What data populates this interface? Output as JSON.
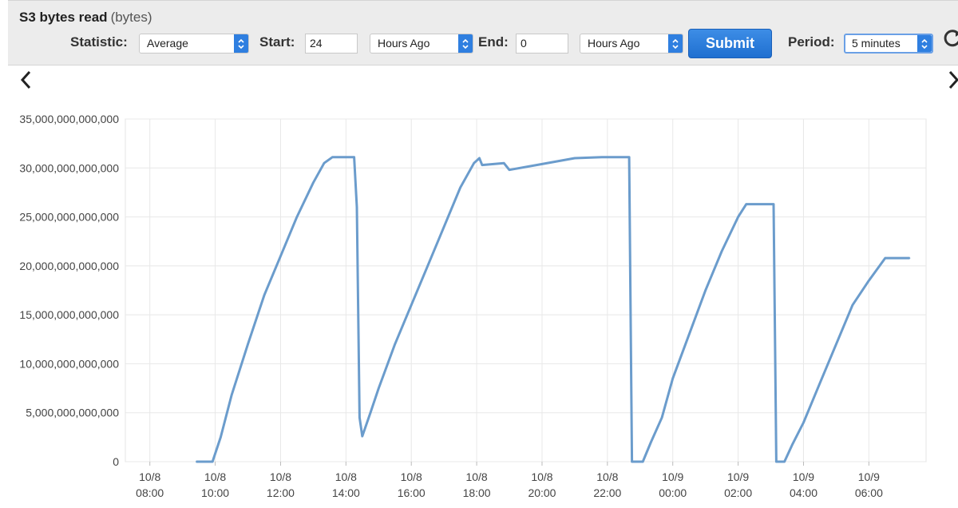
{
  "toolbar": {
    "title": "S3 bytes read",
    "units": "(bytes)",
    "statistic_label": "Statistic:",
    "statistic_value": "Average",
    "start_label": "Start:",
    "start_value": "24",
    "start_unit": "Hours Ago",
    "end_label": "End:",
    "end_value": "0",
    "end_unit": "Hours Ago",
    "submit_label": "Submit",
    "period_label": "Period:",
    "period_value": "5 minutes"
  },
  "icons": {
    "select_arrow": "up-down-chevron-icon",
    "prev": "chevron-left-icon",
    "next": "chevron-right-icon",
    "refresh": "refresh-icon"
  },
  "colors": {
    "line": "#6b9ccc",
    "accent": "#2f7fe0",
    "grid": "#e8e8e8"
  },
  "chart_data": {
    "type": "line",
    "title": "S3 bytes read",
    "ylabel": "(bytes)",
    "xlabel": "",
    "ylim": [
      0,
      35000000000000
    ],
    "xlim": [
      "10/8 07:15",
      "10/9 07:45"
    ],
    "grid": true,
    "y_ticks": [
      0,
      5000000000000,
      10000000000000,
      15000000000000,
      20000000000000,
      25000000000000,
      30000000000000,
      35000000000000
    ],
    "y_tick_labels": [
      "0",
      "5,000,000,000,000",
      "10,000,000,000,000",
      "15,000,000,000,000",
      "20,000,000,000,000",
      "25,000,000,000,000",
      "30,000,000,000,000",
      "35,000,000,000,000"
    ],
    "x_ticks": [
      "10/8 08:00",
      "10/8 10:00",
      "10/8 12:00",
      "10/8 14:00",
      "10/8 16:00",
      "10/8 18:00",
      "10/8 20:00",
      "10/8 22:00",
      "10/9 00:00",
      "10/9 02:00",
      "10/9 04:00",
      "10/9 06:00"
    ],
    "x_tick_labels": [
      [
        "10/8",
        "08:00"
      ],
      [
        "10/8",
        "10:00"
      ],
      [
        "10/8",
        "12:00"
      ],
      [
        "10/8",
        "14:00"
      ],
      [
        "10/8",
        "16:00"
      ],
      [
        "10/8",
        "18:00"
      ],
      [
        "10/8",
        "20:00"
      ],
      [
        "10/8",
        "22:00"
      ],
      [
        "10/9",
        "00:00"
      ],
      [
        "10/9",
        "02:00"
      ],
      [
        "10/9",
        "04:00"
      ],
      [
        "10/9",
        "06:00"
      ]
    ],
    "series": [
      {
        "points": [
          [
            "10/8 09:25",
            0
          ],
          [
            "10/8 09:55",
            0
          ],
          [
            "10/8 10:10",
            2500000000000
          ],
          [
            "10/8 10:30",
            6800000000000
          ],
          [
            "10/8 11:00",
            12000000000000
          ],
          [
            "10/8 11:30",
            17000000000000
          ],
          [
            "10/8 12:00",
            21000000000000
          ],
          [
            "10/8 12:30",
            25000000000000
          ],
          [
            "10/8 13:00",
            28500000000000
          ],
          [
            "10/8 13:20",
            30500000000000
          ],
          [
            "10/8 13:35",
            31100000000000
          ],
          [
            "10/8 14:15",
            31100000000000
          ],
          [
            "10/8 14:20",
            26000000000000
          ],
          [
            "10/8 14:25",
            4500000000000
          ],
          [
            "10/8 14:30",
            2600000000000
          ],
          [
            "10/8 14:45",
            5000000000000
          ],
          [
            "10/8 15:00",
            7500000000000
          ],
          [
            "10/8 15:30",
            12000000000000
          ],
          [
            "10/8 16:00",
            16000000000000
          ],
          [
            "10/8 16:30",
            20000000000000
          ],
          [
            "10/8 17:00",
            24000000000000
          ],
          [
            "10/8 17:30",
            28000000000000
          ],
          [
            "10/8 17:55",
            30500000000000
          ],
          [
            "10/8 18:05",
            31000000000000
          ],
          [
            "10/8 18:10",
            30300000000000
          ],
          [
            "10/8 18:50",
            30500000000000
          ],
          [
            "10/8 19:00",
            29800000000000
          ],
          [
            "10/8 20:00",
            30400000000000
          ],
          [
            "10/8 21:00",
            31000000000000
          ],
          [
            "10/8 21:50",
            31100000000000
          ],
          [
            "10/8 22:40",
            31100000000000
          ],
          [
            "10/8 22:45",
            0
          ],
          [
            "10/8 23:05",
            0
          ],
          [
            "10/8 23:20",
            2000000000000
          ],
          [
            "10/8 23:40",
            4500000000000
          ],
          [
            "10/9 00:00",
            8500000000000
          ],
          [
            "10/9 00:30",
            13000000000000
          ],
          [
            "10/9 01:00",
            17500000000000
          ],
          [
            "10/9 01:30",
            21500000000000
          ],
          [
            "10/9 02:00",
            25000000000000
          ],
          [
            "10/9 02:15",
            26300000000000
          ],
          [
            "10/9 03:05",
            26300000000000
          ],
          [
            "10/9 03:10",
            0
          ],
          [
            "10/9 03:25",
            0
          ],
          [
            "10/9 03:40",
            1800000000000
          ],
          [
            "10/9 04:00",
            4000000000000
          ],
          [
            "10/9 04:30",
            8000000000000
          ],
          [
            "10/9 05:00",
            12000000000000
          ],
          [
            "10/9 05:30",
            16000000000000
          ],
          [
            "10/9 06:00",
            18500000000000
          ],
          [
            "10/9 06:30",
            20800000000000
          ],
          [
            "10/9 07:15",
            20800000000000
          ]
        ]
      }
    ]
  }
}
